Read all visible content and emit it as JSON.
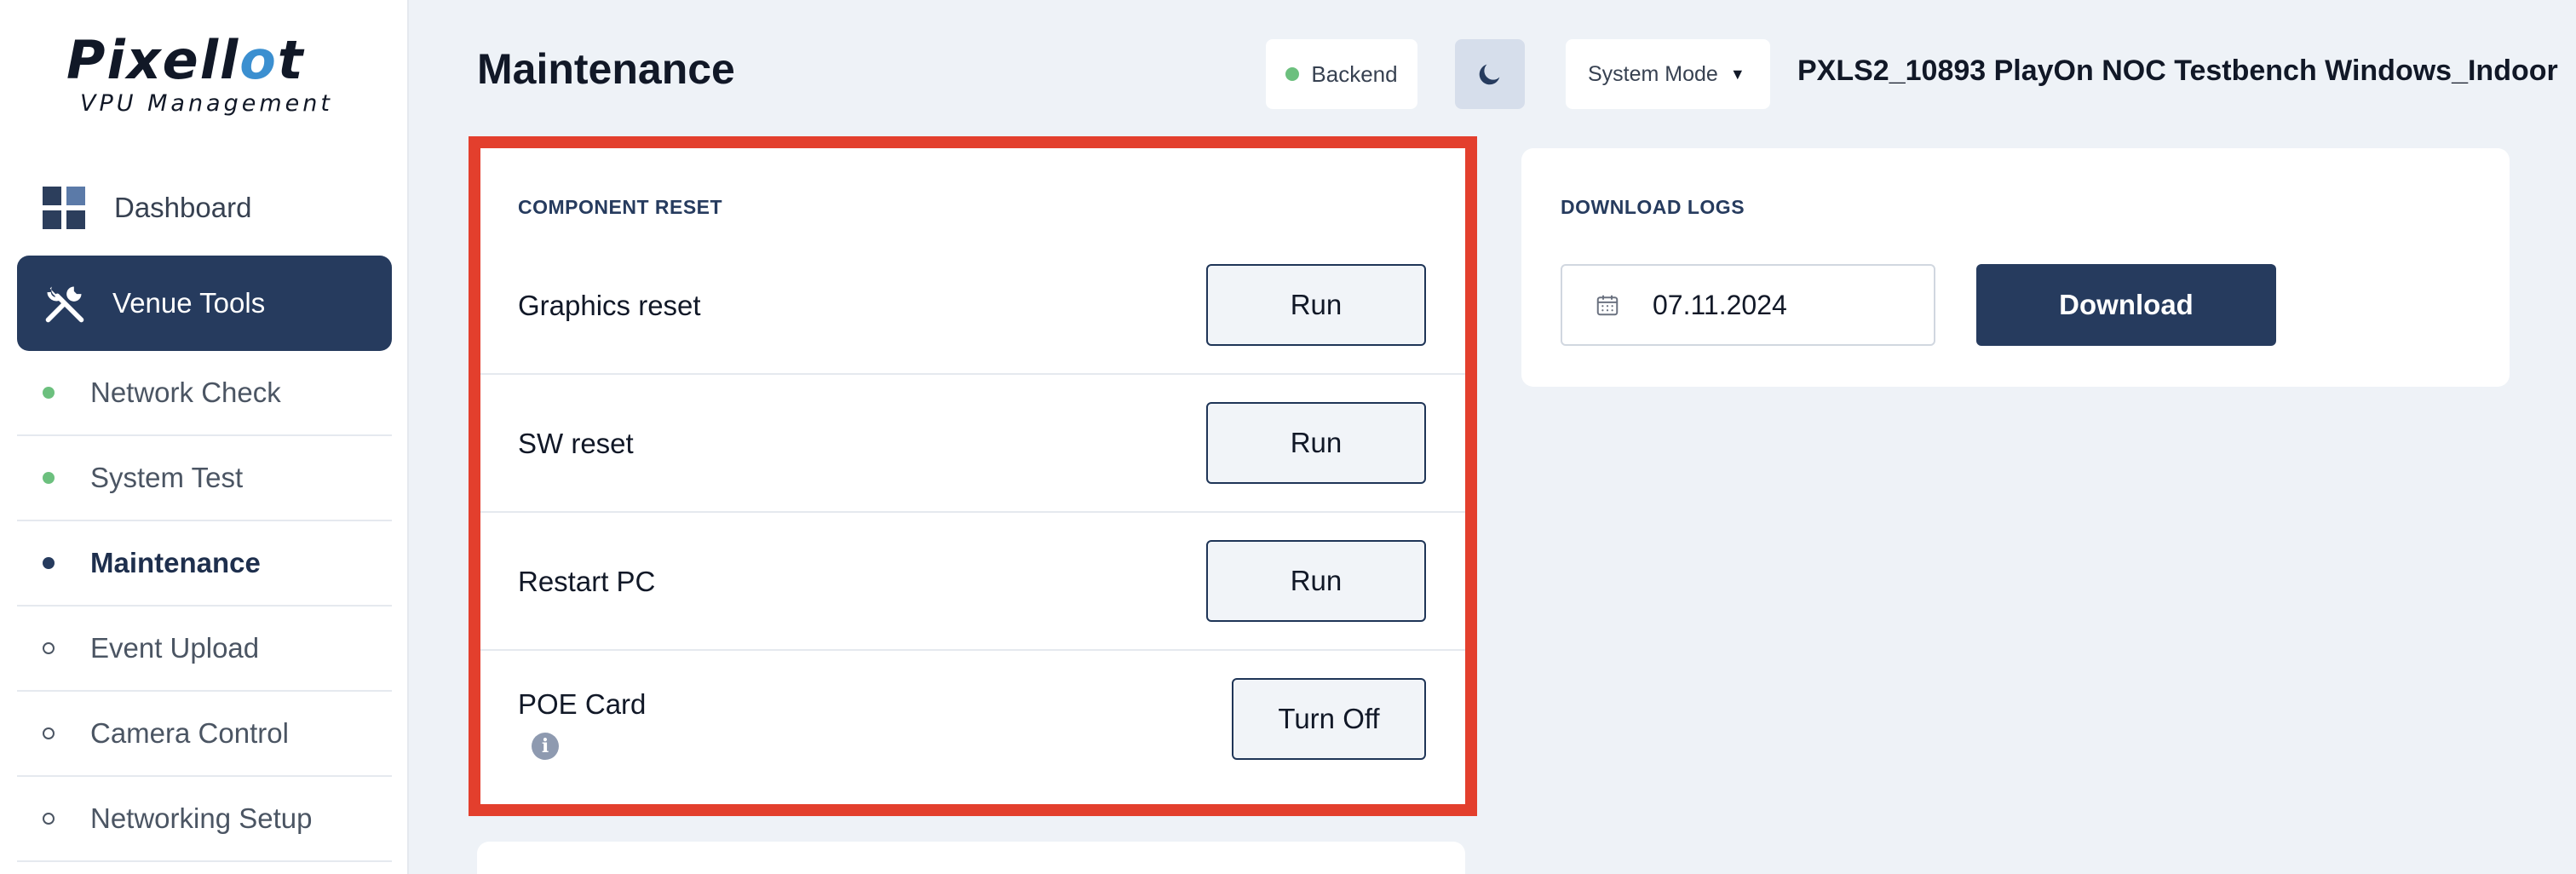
{
  "brand": {
    "logo_main": "Pixell",
    "logo_accent": "o",
    "logo_end": "t",
    "logo_sub": "VPU Management"
  },
  "sidebar": {
    "dashboard_label": "Dashboard",
    "venue_tools_label": "Venue Tools",
    "sub_items": [
      {
        "label": "Network Check",
        "status": "green"
      },
      {
        "label": "System Test",
        "status": "green"
      },
      {
        "label": "Maintenance",
        "status": "active"
      },
      {
        "label": "Event Upload",
        "status": "hollow"
      },
      {
        "label": "Camera Control",
        "status": "hollow"
      },
      {
        "label": "Networking Setup",
        "status": "hollow"
      }
    ]
  },
  "header": {
    "title": "Maintenance",
    "backend_label": "Backend",
    "backend_status_color": "#6cc07e",
    "mode_label": "System Mode",
    "device_name": "PXLS2_10893 PlayOn NOC Testbench Windows_Indoor"
  },
  "component_reset": {
    "section_title": "COMPONENT RESET",
    "rows": [
      {
        "label": "Graphics reset",
        "button": "Run"
      },
      {
        "label": "SW reset",
        "button": "Run"
      },
      {
        "label": "Restart PC",
        "button": "Run"
      },
      {
        "label": "POE Card",
        "button": "Turn Off"
      }
    ],
    "info_glyph": "i"
  },
  "download_logs": {
    "section_title": "DOWNLOAD LOGS",
    "date_value": "07.11.2024",
    "download_label": "Download"
  },
  "colors": {
    "accent_dark": "#263b5e",
    "highlight_red": "#e33f2d",
    "status_green": "#6cc07e",
    "background": "#eef2f7"
  }
}
